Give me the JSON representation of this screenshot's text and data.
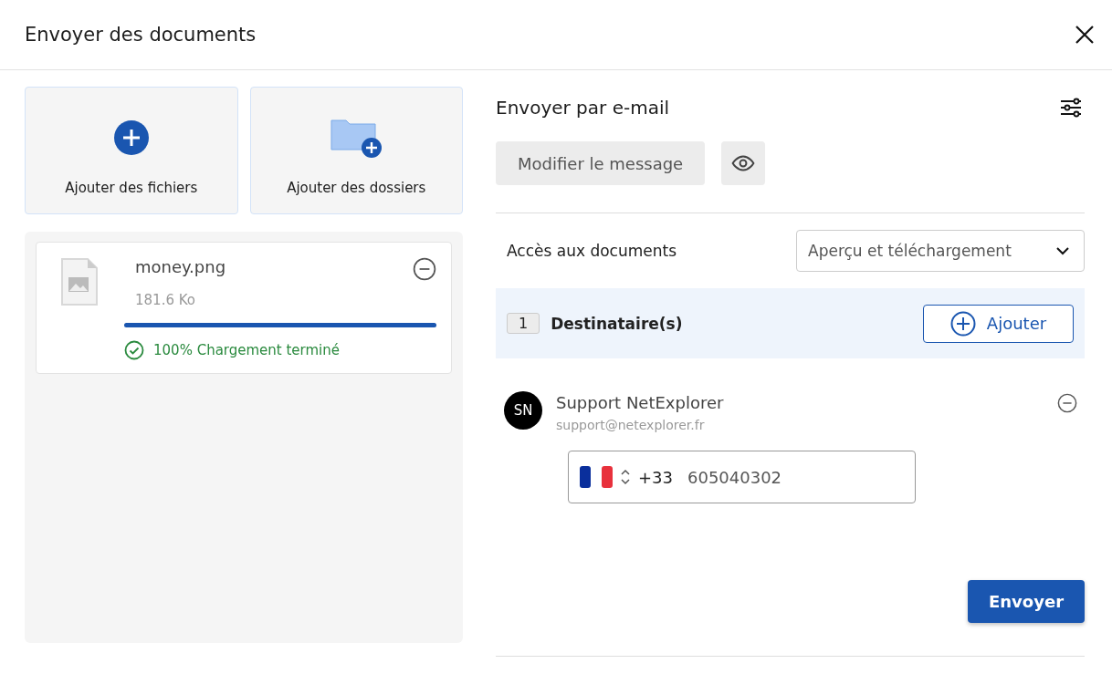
{
  "window": {
    "title": "Envoyer des documents"
  },
  "add_tiles": [
    {
      "kind": "files",
      "label": "Ajouter des fichiers"
    },
    {
      "kind": "folders",
      "label": "Ajouter des dossiers"
    }
  ],
  "files": [
    {
      "name": "money.png",
      "size": "181.6 Ko",
      "level": 1,
      "status": "100% Chargement terminé"
    }
  ],
  "email": {
    "title": "Envoyer par e-mail",
    "edit_button": "Modifier le message"
  },
  "access": {
    "label": "Accès aux documents",
    "value": "Aperçu et téléchargement"
  },
  "recipients": {
    "count": "1",
    "label": "Destinataire(s)",
    "add_button": "Ajouter",
    "items": [
      {
        "initials": "SN",
        "name": "Support NetExplorer",
        "email": "support@netexplorer.fr",
        "phone_code": "+33",
        "phone": "605040302"
      }
    ]
  },
  "send_button": "Envoyer"
}
